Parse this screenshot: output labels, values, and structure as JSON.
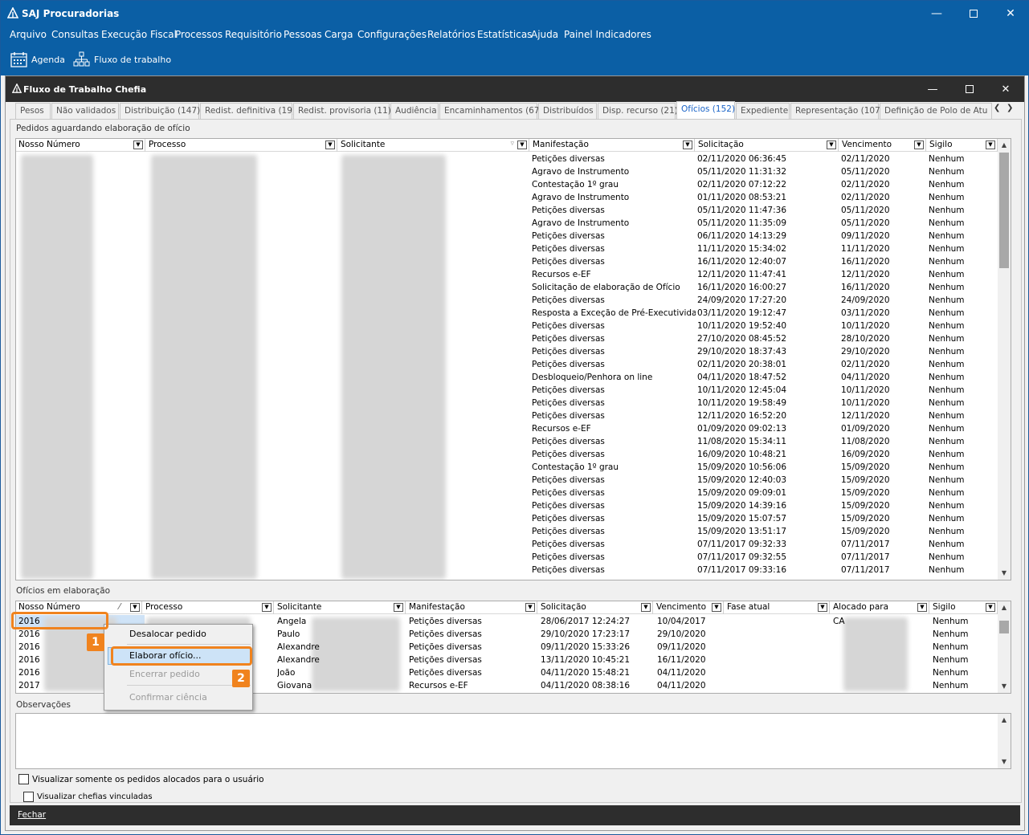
{
  "app": {
    "title": "SAJ Procuradorias",
    "window_controls": [
      "minimize-icon",
      "maximize-icon",
      "close-icon"
    ]
  },
  "menu": [
    "Arquivo",
    "Consultas",
    "Execução Fiscal",
    "Processos",
    "Requisitório",
    "Pessoas",
    "Carga",
    "Configurações",
    "Relatórios",
    "Estatísticas",
    "Ajuda",
    "Painel Indicadores"
  ],
  "toolbar": {
    "agenda": "Agenda",
    "workflow": "Fluxo de trabalho"
  },
  "inner": {
    "title": "Fluxo de Trabalho Chefia"
  },
  "tabs": [
    "Pesos",
    "Não validados",
    "Distribuição (147)",
    "Redist. definitiva (19)",
    "Redist. provisoria (11)",
    "Audiência",
    "Encaminhamentos (67)",
    "Distribuídos",
    "Disp. recurso (21)",
    "Ofícios (152)",
    "Expediente",
    "Representação (107)",
    "Definição de Polo de Atu"
  ],
  "active_tab": "Ofícios (152)",
  "top_section": {
    "title": "Pedidos aguardando elaboração de ofício",
    "columns": [
      "Nosso Número",
      "Processo",
      "Solicitante",
      "Manifestação",
      "Solicitação",
      "Vencimento",
      "Sigilo"
    ],
    "rows": [
      [
        "Petições diversas",
        "02/11/2020 06:36:45",
        "02/11/2020",
        "Nenhum"
      ],
      [
        "Agravo de Instrumento",
        "05/11/2020 11:31:32",
        "05/11/2020",
        "Nenhum"
      ],
      [
        "Contestação 1º grau",
        "02/11/2020 07:12:22",
        "02/11/2020",
        "Nenhum"
      ],
      [
        "Agravo de Instrumento",
        "01/11/2020 08:53:21",
        "02/11/2020",
        "Nenhum"
      ],
      [
        "Petições diversas",
        "05/11/2020 11:47:36",
        "05/11/2020",
        "Nenhum"
      ],
      [
        "Agravo de Instrumento",
        "05/11/2020 11:35:09",
        "05/11/2020",
        "Nenhum"
      ],
      [
        "Petições diversas",
        "06/11/2020 14:13:29",
        "09/11/2020",
        "Nenhum"
      ],
      [
        "Petições diversas",
        "11/11/2020 15:34:02",
        "11/11/2020",
        "Nenhum"
      ],
      [
        "Petições diversas",
        "16/11/2020 12:40:07",
        "16/11/2020",
        "Nenhum"
      ],
      [
        "Recursos e-EF",
        "12/11/2020 11:47:41",
        "12/11/2020",
        "Nenhum"
      ],
      [
        "Solicitação de elaboração de Ofício",
        "16/11/2020 16:00:27",
        "16/11/2020",
        "Nenhum"
      ],
      [
        "Petições diversas",
        "24/09/2020 17:27:20",
        "24/09/2020",
        "Nenhum"
      ],
      [
        "Resposta a Exceção de Pré-Executividade",
        "03/11/2020 19:12:47",
        "03/11/2020",
        "Nenhum"
      ],
      [
        "Petições diversas",
        "10/11/2020 19:52:40",
        "10/11/2020",
        "Nenhum"
      ],
      [
        "Petições diversas",
        "27/10/2020 08:45:52",
        "28/10/2020",
        "Nenhum"
      ],
      [
        "Petições diversas",
        "29/10/2020 18:37:43",
        "29/10/2020",
        "Nenhum"
      ],
      [
        "Petições diversas",
        "02/11/2020 20:38:01",
        "02/11/2020",
        "Nenhum"
      ],
      [
        "Desbloqueio/Penhora on line",
        "04/11/2020 18:47:52",
        "04/11/2020",
        "Nenhum"
      ],
      [
        "Petições diversas",
        "10/11/2020 12:45:04",
        "10/11/2020",
        "Nenhum"
      ],
      [
        "Petições diversas",
        "10/11/2020 19:58:49",
        "10/11/2020",
        "Nenhum"
      ],
      [
        "Petições diversas",
        "12/11/2020 16:52:20",
        "12/11/2020",
        "Nenhum"
      ],
      [
        "Recursos e-EF",
        "01/09/2020 09:02:13",
        "01/09/2020",
        "Nenhum"
      ],
      [
        "Petições diversas",
        "11/08/2020 15:34:11",
        "11/08/2020",
        "Nenhum"
      ],
      [
        "Petições diversas",
        "16/09/2020 10:48:21",
        "16/09/2020",
        "Nenhum"
      ],
      [
        "Contestação 1º grau",
        "15/09/2020 10:56:06",
        "15/09/2020",
        "Nenhum"
      ],
      [
        "Petições diversas",
        "15/09/2020 12:40:03",
        "15/09/2020",
        "Nenhum"
      ],
      [
        "Petições diversas",
        "15/09/2020 09:09:01",
        "15/09/2020",
        "Nenhum"
      ],
      [
        "Petições diversas",
        "15/09/2020 14:39:16",
        "15/09/2020",
        "Nenhum"
      ],
      [
        "Petições diversas",
        "15/09/2020 15:07:57",
        "15/09/2020",
        "Nenhum"
      ],
      [
        "Petições diversas",
        "15/09/2020 13:51:17",
        "15/09/2020",
        "Nenhum"
      ],
      [
        "Petições diversas",
        "07/11/2017 09:32:33",
        "07/11/2017",
        "Nenhum"
      ],
      [
        "Petições diversas",
        "07/11/2017 09:32:55",
        "07/11/2017",
        "Nenhum"
      ],
      [
        "Petições diversas",
        "07/11/2017 09:33:16",
        "07/11/2017",
        "Nenhum"
      ]
    ]
  },
  "bottom_section": {
    "title": "Ofícios em elaboração",
    "columns": [
      "Nosso Número",
      "Processo",
      "Solicitante",
      "Manifestação",
      "Solicitação",
      "Vencimento",
      "Fase atual",
      "Alocado para",
      "Sigilo"
    ],
    "rows": [
      [
        "2016",
        "Angela",
        "Petições diversas",
        "28/06/2017 12:24:27",
        "10/04/2017",
        "CA",
        "Nenhum"
      ],
      [
        "2016",
        "Paulo",
        "Petições diversas",
        "29/10/2020 17:23:17",
        "29/10/2020",
        "",
        "Nenhum"
      ],
      [
        "2016",
        "Alexandre",
        "Petições diversas",
        "09/11/2020 15:33:26",
        "09/11/2020",
        "",
        "Nenhum"
      ],
      [
        "2016",
        "Alexandre",
        "Petições diversas",
        "13/11/2020 10:45:21",
        "16/11/2020",
        "",
        "Nenhum"
      ],
      [
        "2016",
        "João",
        "Petições diversas",
        "04/11/2020 15:48:21",
        "04/11/2020",
        "",
        "Nenhum"
      ],
      [
        "2017",
        "Giovana",
        "Recursos e-EF",
        "04/11/2020 08:38:16",
        "04/11/2020",
        "",
        "Nenhum"
      ]
    ]
  },
  "observations": {
    "title": "Observações"
  },
  "context_menu": {
    "items": [
      "Desalocar pedido",
      "Elaborar ofício...",
      "Encerrar pedido",
      "Confirmar ciência"
    ]
  },
  "callouts": [
    "1",
    "2"
  ],
  "checkboxes": {
    "only_allocated": "Visualizar somente os pedidos alocados para o usuário",
    "linked": "Visualizar chefias vinculadas"
  },
  "footer": {
    "close": "Fechar"
  },
  "colors": {
    "titlebar": "#0b5fa5",
    "inner_titlebar": "#2d2d2d",
    "callout": "#f0831e",
    "active_tab": "#1a64c8"
  }
}
